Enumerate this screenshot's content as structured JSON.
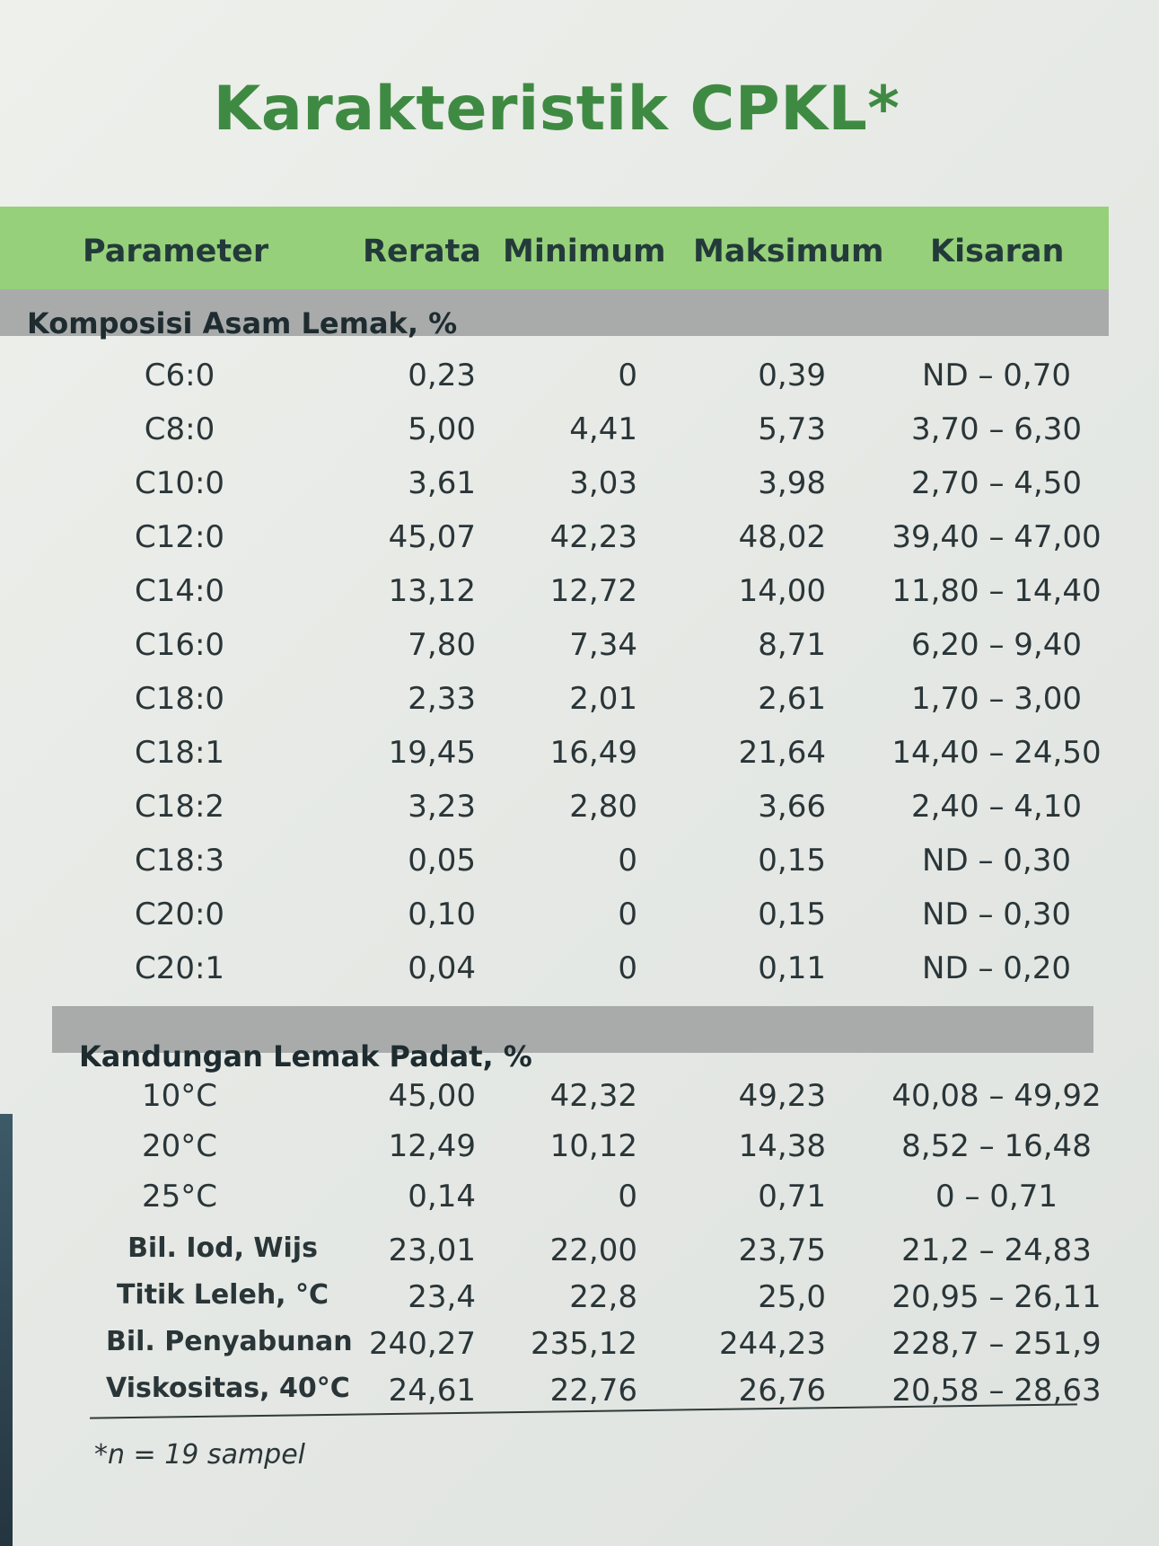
{
  "title": "Karakteristik CPKL*",
  "colors": {
    "header_green": "#96d07a",
    "title_green": "#3f8a42",
    "section_gray": "#a9abab"
  },
  "headers": [
    "Parameter",
    "Rerata",
    "Minimum",
    "Maksimum",
    "Kisaran"
  ],
  "sections": [
    {
      "label": "Komposisi Asam Lemak, %",
      "rows": [
        [
          "C6:0",
          "0,23",
          "0",
          "0,39",
          "ND – 0,70"
        ],
        [
          "C8:0",
          "5,00",
          "4,41",
          "5,73",
          "3,70 – 6,30"
        ],
        [
          "C10:0",
          "3,61",
          "3,03",
          "3,98",
          "2,70 – 4,50"
        ],
        [
          "C12:0",
          "45,07",
          "42,23",
          "48,02",
          "39,40 – 47,00"
        ],
        [
          "C14:0",
          "13,12",
          "12,72",
          "14,00",
          "11,80 – 14,40"
        ],
        [
          "C16:0",
          "7,80",
          "7,34",
          "8,71",
          "6,20 – 9,40"
        ],
        [
          "C18:0",
          "2,33",
          "2,01",
          "2,61",
          "1,70 – 3,00"
        ],
        [
          "C18:1",
          "19,45",
          "16,49",
          "21,64",
          "14,40 – 24,50"
        ],
        [
          "C18:2",
          "3,23",
          "2,80",
          "3,66",
          "2,40 – 4,10"
        ],
        [
          "C18:3",
          "0,05",
          "0",
          "0,15",
          "ND – 0,30"
        ],
        [
          "C20:0",
          "0,10",
          "0",
          "0,15",
          "ND – 0,30"
        ],
        [
          "C20:1",
          "0,04",
          "0",
          "0,11",
          "ND – 0,20"
        ]
      ]
    },
    {
      "label": "Kandungan Lemak Padat, %",
      "rows": [
        [
          "10°C",
          "45,00",
          "42,32",
          "49,23",
          "40,08 – 49,92"
        ],
        [
          "20°C",
          "12,49",
          "10,12",
          "14,38",
          "8,52 – 16,48"
        ],
        [
          "25°C",
          "0,14",
          "0",
          "0,71",
          "0 – 0,71"
        ]
      ]
    }
  ],
  "extra_rows": [
    [
      "Bil. Iod, Wijs",
      "23,01",
      "22,00",
      "23,75",
      "21,2 – 24,83"
    ],
    [
      "Titik Leleh, °C",
      "23,4",
      "22,8",
      "25,0",
      "20,95 – 26,11"
    ],
    [
      "Bil. Penyabunan",
      "240,27",
      "235,12",
      "244,23",
      "228,7 – 251,9"
    ],
    [
      "Viskositas, 40°C",
      "24,61",
      "22,76",
      "26,76",
      "20,58 – 28,63"
    ]
  ],
  "footnote": "*n = 19 sampel"
}
